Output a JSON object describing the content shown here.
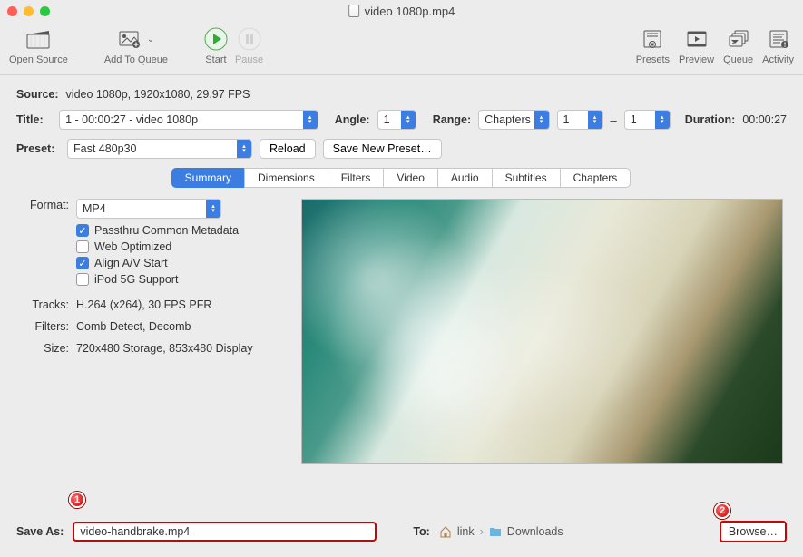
{
  "window": {
    "title": "video 1080p.mp4"
  },
  "toolbar": {
    "open": "Open Source",
    "add": "Add To Queue",
    "start": "Start",
    "pause": "Pause",
    "presets": "Presets",
    "preview": "Preview",
    "queue": "Queue",
    "activity": "Activity"
  },
  "source": {
    "label": "Source:",
    "value": "video 1080p, 1920x1080, 29.97 FPS"
  },
  "title_row": {
    "label": "Title:",
    "value": "1 - 00:00:27 - video 1080p",
    "angle_label": "Angle:",
    "angle_value": "1",
    "range_label": "Range:",
    "range_mode": "Chapters",
    "range_from": "1",
    "range_sep": "–",
    "range_to": "1",
    "duration_label": "Duration:",
    "duration_value": "00:00:27"
  },
  "preset_row": {
    "label": "Preset:",
    "value": "Fast 480p30",
    "reload": "Reload",
    "save_new": "Save New Preset…"
  },
  "tabs": [
    "Summary",
    "Dimensions",
    "Filters",
    "Video",
    "Audio",
    "Subtitles",
    "Chapters"
  ],
  "summary": {
    "format_label": "Format:",
    "format_value": "MP4",
    "check_passthru": "Passthru Common Metadata",
    "check_web": "Web Optimized",
    "check_align": "Align A/V Start",
    "check_ipod": "iPod 5G Support",
    "tracks_label": "Tracks:",
    "tracks_value": "H.264 (x264), 30 FPS PFR",
    "filters_label": "Filters:",
    "filters_value": "Comb Detect, Decomb",
    "size_label": "Size:",
    "size_value": "720x480 Storage, 853x480 Display"
  },
  "bottom": {
    "saveas_label": "Save As:",
    "saveas_value": "video-handbrake.mp4",
    "to_label": "To:",
    "path_parent": "link",
    "path_folder": "Downloads",
    "browse": "Browse…"
  },
  "markers": {
    "one": "1",
    "two": "2"
  }
}
